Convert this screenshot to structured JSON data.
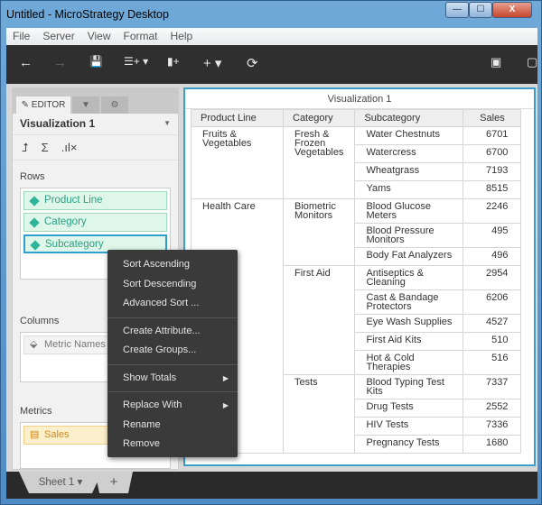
{
  "window": {
    "title": "Untitled - MicroStrategy Desktop",
    "minimize": "—",
    "maximize": "☐",
    "close": "X"
  },
  "menu": [
    "File",
    "Server",
    "View",
    "Format",
    "Help"
  ],
  "toolbar": {
    "undo": "←",
    "redo": "→",
    "save": "💾",
    "add_data": "☰+ ▾",
    "insert_viz": "▮+",
    "add": "+ ▾",
    "refresh": "⟳",
    "right1": "▣",
    "right2": "▢"
  },
  "editor": {
    "tab_editor": "EDITOR",
    "tab_filter": "▼",
    "tab_settings": "⚙",
    "viz_name": "Visualization 1",
    "icons": {
      "swap": "⮥",
      "sum": "Σ",
      "chart": ".ıl×"
    },
    "rows_label": "Rows",
    "rows": [
      "Product Line",
      "Category",
      "Subcategory"
    ],
    "columns_label": "Columns",
    "columns": [
      "Metric Names"
    ],
    "metrics_label": "Metrics",
    "metrics": [
      "Sales"
    ]
  },
  "viz": {
    "title": "Visualization 1",
    "headers": [
      "Product Line",
      "Category",
      "Subcategory",
      "Sales"
    ],
    "groups": [
      {
        "product_line": "Fruits & Vegetables",
        "categories": [
          {
            "name": "Fresh & Frozen Vegetables",
            "rows": [
              [
                "Water Chestnuts",
                "6701"
              ],
              [
                "Watercress",
                "6700"
              ],
              [
                "Wheatgrass",
                "7193"
              ],
              [
                "Yams",
                "8515"
              ]
            ]
          }
        ]
      },
      {
        "product_line": "Health Care",
        "categories": [
          {
            "name": "Biometric Monitors",
            "rows": [
              [
                "Blood Glucose Meters",
                "2246"
              ],
              [
                "Blood Pressure Monitors",
                "495"
              ],
              [
                "Body Fat Analyzers",
                "496"
              ]
            ]
          },
          {
            "name": "First Aid",
            "rows": [
              [
                "Antiseptics & Cleaning",
                "2954"
              ],
              [
                "Cast & Bandage Protectors",
                "6206"
              ],
              [
                "Eye Wash Supplies",
                "4527"
              ],
              [
                "First Aid Kits",
                "510"
              ],
              [
                "Hot & Cold Therapies",
                "516"
              ]
            ]
          },
          {
            "name": "Tests",
            "rows": [
              [
                "Blood Typing Test Kits",
                "7337"
              ],
              [
                "Drug Tests",
                "2552"
              ],
              [
                "HIV Tests",
                "7336"
              ],
              [
                "Pregnancy Tests",
                "1680"
              ]
            ]
          }
        ]
      }
    ]
  },
  "context_menu": {
    "groups": [
      [
        "Sort Ascending",
        "Sort Descending",
        "Advanced Sort ..."
      ],
      [
        "Create Attribute...",
        "Create Groups..."
      ],
      [
        "Show Totals"
      ],
      [
        "Replace With",
        "Rename",
        "Remove"
      ]
    ],
    "submenu_items": [
      "Show Totals",
      "Replace With"
    ]
  },
  "sheets": {
    "sheet1": "Sheet 1 ▾",
    "add": "+"
  }
}
